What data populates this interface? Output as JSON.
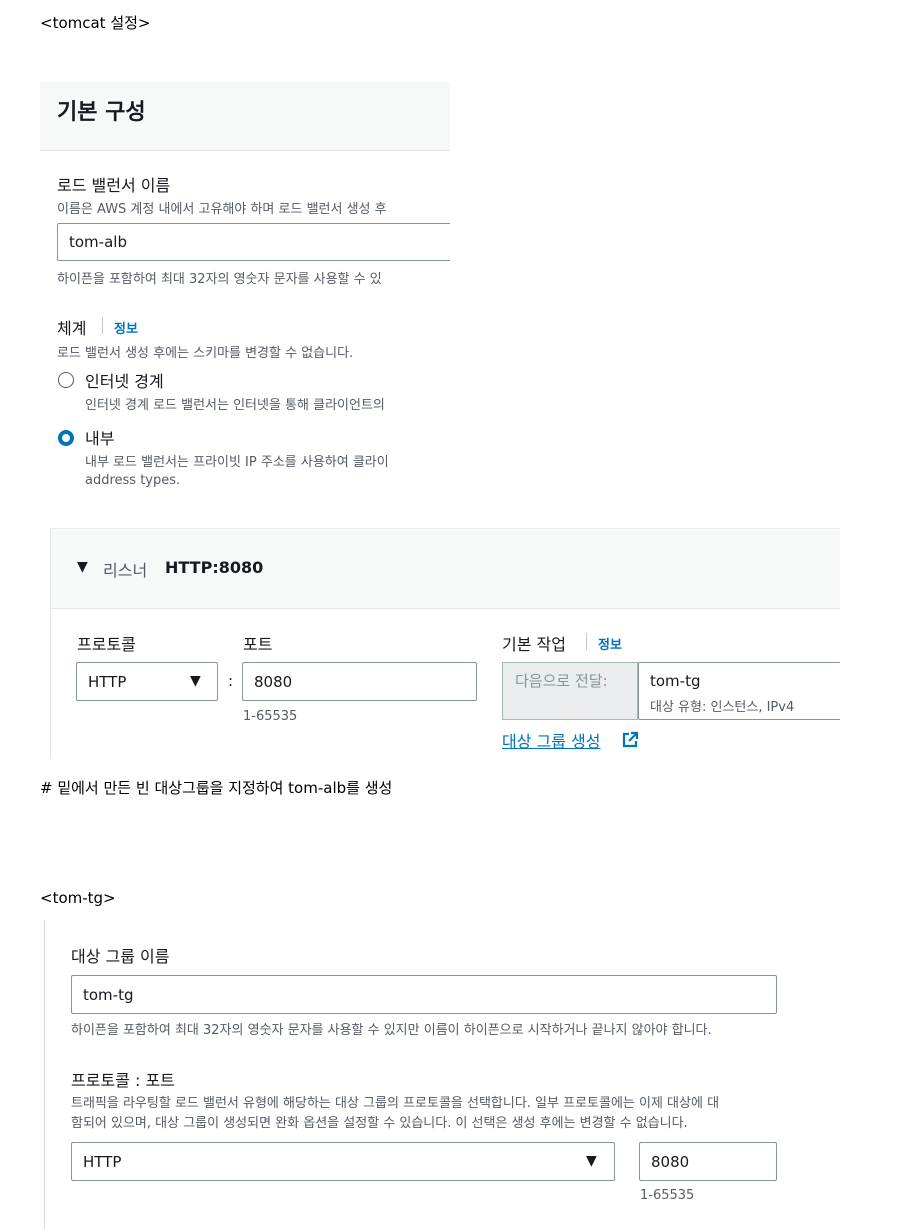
{
  "section1": {
    "heading": "<tomcat 설정>"
  },
  "panel1": {
    "title": "기본 구성",
    "lb_name": {
      "label": "로드 밸런서 이름",
      "description": "이름은 AWS 계정 내에서 고유해야 하며 로드 밸런서 생성 후",
      "value": "tom-alb",
      "hint": "하이픈을 포함하여 최대 32자의 영숫자 문자를 사용할 수 있"
    },
    "scheme": {
      "label": "체계",
      "info": "정보",
      "description": "로드 밸런서 생성 후에는 스키마를 변경할 수 없습니다.",
      "options": [
        {
          "label": "인터넷 경계",
          "description": "인터넷 경계 로드 밸런서는 인터넷을 통해 클라이언트의",
          "selected": false
        },
        {
          "label": "내부",
          "description": "내부 로드 밸런서는 프라이빗 IP 주소를 사용하여 클라이",
          "description2": "address types.",
          "selected": true
        }
      ]
    }
  },
  "listener": {
    "caret": "▼",
    "label": "리스너",
    "value": "HTTP:8080",
    "protocol_label": "프로토콜",
    "protocol_value": "HTTP",
    "colon": ":",
    "port_label": "포트",
    "port_value": "8080",
    "port_hint": "1-65535",
    "default_action_label": "기본 작업",
    "info": "정보",
    "forward_to": "다음으로 전달:",
    "target_group_name": "tom-tg",
    "target_group_meta": "대상 유형: 인스턴스, IPv4",
    "create_tg_link": "대상 그룹 생성"
  },
  "note": "# 밑에서 만든 빈 대상그룹을 지정하여 tom-alb를 생성",
  "section2": {
    "heading": "<tom-tg>"
  },
  "panel2": {
    "tg_name_label": "대상 그룹 이름",
    "tg_name_value": "tom-tg",
    "tg_name_hint": "하이픈을 포함하여 최대 32자의 영숫자 문자를 사용할 수 있지만 이름이 하이픈으로 시작하거나 끝나지 않아야 합니다.",
    "protocol_port_label": "프로토콜 : 포트",
    "protocol_port_desc1": "트래픽을 라우팅할 로드 밸런서 유형에 해당하는 대상 그룹의 프로토콜을 선택합니다. 일부 프로토콜에는 이제 대상에 대",
    "protocol_port_desc2": "함되어 있으며, 대상 그룹이 생성되면 완화 옵션을 설정할 수 있습니다. 이 선택은 생성 후에는 변경할 수 없습니다.",
    "protocol_value": "HTTP",
    "port_value": "8080",
    "port_hint": "1-65535"
  },
  "colors": {
    "link": "#0073bb",
    "radio_selected": "#0073bb",
    "panel_header_bg": "#f7f8f8"
  }
}
